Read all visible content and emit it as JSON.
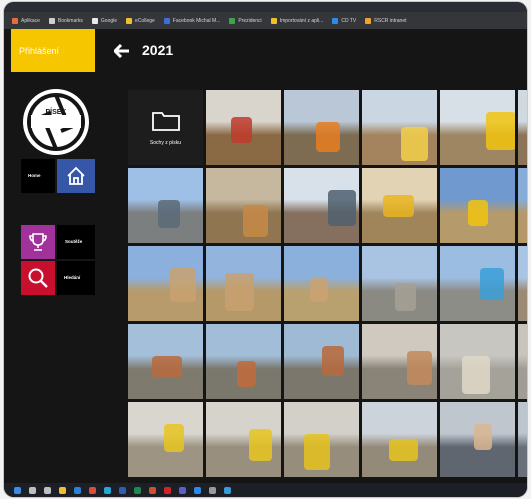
{
  "bookmarks": [
    {
      "label": "Aplikace",
      "icon": "apps-icon",
      "color": "#e56d3a"
    },
    {
      "label": "Bookmarks",
      "icon": "bookmark-icon",
      "color": "#cfcfcf"
    },
    {
      "label": "Google",
      "icon": "google-icon",
      "color": "#e9e9e9"
    },
    {
      "label": "eCollege",
      "icon": "folder-icon",
      "color": "#f0c02c"
    },
    {
      "label": "Facebook Michal M...",
      "icon": "facebook-icon",
      "color": "#3b6fdb"
    },
    {
      "label": "Prezidenci",
      "icon": "sheet-icon",
      "color": "#3da44d"
    },
    {
      "label": "Importování z apli...",
      "icon": "folder-icon",
      "color": "#f0c02c"
    },
    {
      "label": "CD TV",
      "icon": "cloud-icon",
      "color": "#2a8be8"
    },
    {
      "label": "RSCR intranet",
      "icon": "circle-icon",
      "color": "#f2a227"
    }
  ],
  "header": {
    "login_label": "Přihlášení",
    "year": "2021"
  },
  "logo": {
    "text": "PÍSEK"
  },
  "nav": {
    "home_label": "Home",
    "soutez_label": "Soutěže",
    "hledani_label": "Hledání"
  },
  "gallery": {
    "folder_name": "Sochy z písku",
    "tiles": [
      {
        "type": "folder"
      },
      {
        "sky": "#d9d4cc",
        "ground": "#8a6a45",
        "accent": "#c0392b"
      },
      {
        "sky": "#b9c7d6",
        "ground": "#7d6b52",
        "accent": "#e67e22"
      },
      {
        "sky": "#cbd6e3",
        "ground": "#a3845f",
        "accent": "#f3d04a"
      },
      {
        "sky": "#d7dfe7",
        "ground": "#9e8663",
        "accent": "#f1c40f"
      },
      {
        "sky": "#d0d8e0",
        "ground": "#8c7459",
        "accent": "#d35400"
      },
      {
        "sky": "#9fc0e6",
        "ground": "#7b7f80",
        "accent": "#5a6a78"
      },
      {
        "sky": "#c5b89f",
        "ground": "#8f7550",
        "accent": "#c78a45"
      },
      {
        "sky": "#d8e1ea",
        "ground": "#857060",
        "accent": "#4f5f6f"
      },
      {
        "sky": "#e3d3b5",
        "ground": "#a0855a",
        "accent": "#e9b520"
      },
      {
        "sky": "#6f99cf",
        "ground": "#b59a6c",
        "accent": "#f1c40f"
      },
      {
        "sky": "#88acd8",
        "ground": "#b49869",
        "accent": "#c9a36c"
      },
      {
        "sky": "#8cb0dd",
        "ground": "#b79b6c",
        "accent": "#c9a270"
      },
      {
        "sky": "#93b4dc",
        "ground": "#b59968",
        "accent": "#c8a06e"
      },
      {
        "sky": "#8bb0dc",
        "ground": "#b9a06f",
        "accent": "#caa271"
      },
      {
        "sky": "#a9c4e3",
        "ground": "#8b8a82",
        "accent": "#a5a096"
      },
      {
        "sky": "#9cbde2",
        "ground": "#8d8d88",
        "accent": "#3a9fd8"
      },
      {
        "sky": "#aac5e4",
        "ground": "#9c8a74",
        "accent": "#c98560"
      },
      {
        "sky": "#a4bfd9",
        "ground": "#7e7a6e",
        "accent": "#b96a3d"
      },
      {
        "sky": "#a1bdd8",
        "ground": "#7a776d",
        "accent": "#c26a3a"
      },
      {
        "sky": "#9fbad5",
        "ground": "#7c776c",
        "accent": "#b8683a"
      },
      {
        "sky": "#cfc9c0",
        "ground": "#8a8377",
        "accent": "#c38a5a"
      },
      {
        "sky": "#c7c6c1",
        "ground": "#a5a29a",
        "accent": "#e0d9c8"
      },
      {
        "sky": "#c9c4bb",
        "ground": "#a19d94",
        "accent": "#b18963"
      },
      {
        "sky": "#d9d6cf",
        "ground": "#9d9483",
        "accent": "#e7c41e"
      },
      {
        "sky": "#d6d3cc",
        "ground": "#998f7f",
        "accent": "#e8c51f"
      },
      {
        "sky": "#d3d0c9",
        "ground": "#978d7c",
        "accent": "#e5c21c"
      },
      {
        "sky": "#cdd3da",
        "ground": "#948a79",
        "accent": "#e6c31d"
      },
      {
        "sky": "#bfc6ce",
        "ground": "#5f6670",
        "accent": "#d9b690"
      },
      {
        "sky": "#bcc4cd",
        "ground": "#6a7079",
        "accent": "#c9a47a"
      }
    ]
  },
  "taskbar": {
    "icons": [
      {
        "icon": "windows-icon",
        "color": "#3c8ce7"
      },
      {
        "icon": "search-icon",
        "color": "#bfbfbf"
      },
      {
        "icon": "task-view-icon",
        "color": "#bfbfbf"
      },
      {
        "icon": "explorer-icon",
        "color": "#f0c02c"
      },
      {
        "icon": "mail-icon",
        "color": "#2d7fd8"
      },
      {
        "icon": "chrome-icon",
        "color": "#e04a3a"
      },
      {
        "icon": "edge-icon",
        "color": "#27a7d8"
      },
      {
        "icon": "word-icon",
        "color": "#2b5fb4"
      },
      {
        "icon": "excel-icon",
        "color": "#1f8a4c"
      },
      {
        "icon": "powerpoint-icon",
        "color": "#d14f2b"
      },
      {
        "icon": "acrobat-icon",
        "color": "#d2232a"
      },
      {
        "icon": "teams-icon",
        "color": "#5b5fc7"
      },
      {
        "icon": "store-icon",
        "color": "#2a8be8"
      },
      {
        "icon": "settings-icon",
        "color": "#9a9a9a"
      },
      {
        "icon": "photos-icon",
        "color": "#3a9ad9"
      }
    ]
  }
}
